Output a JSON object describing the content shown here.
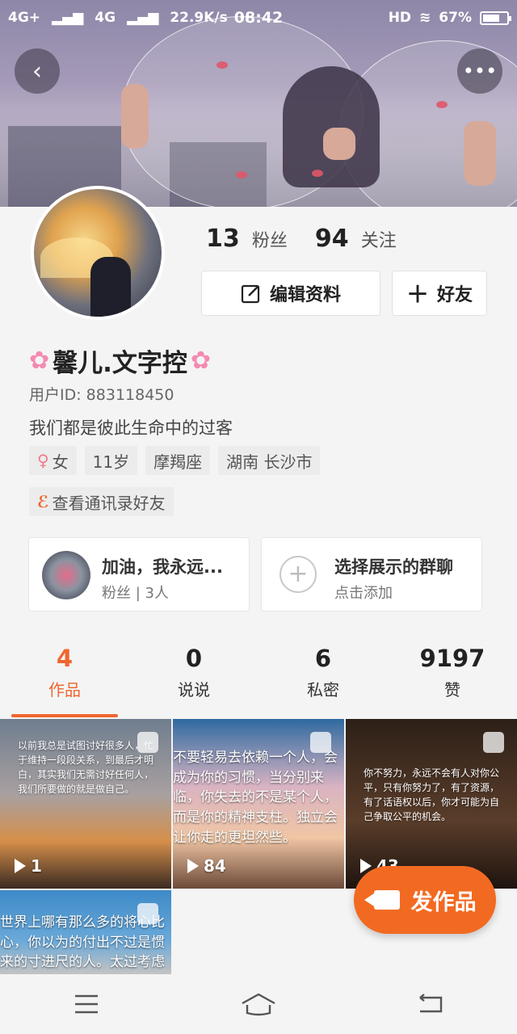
{
  "status_bar": {
    "network_1": "4G+",
    "network_2": "4G",
    "speed": "22.9K/s",
    "dots": "···",
    "time": "08:42",
    "hd": "HD",
    "battery": "67%"
  },
  "header": {
    "back_icon": "chevron-left",
    "more_icon": "ellipsis"
  },
  "profile": {
    "fans_count": "13",
    "fans_label": "粉丝",
    "following_count": "94",
    "following_label": "关注",
    "edit_button": "编辑资料",
    "add_friend_button": "好友",
    "name": "馨儿.文字控",
    "user_id": "用户ID: 883118450",
    "bio": "我们都是彼此生命中的过客",
    "tags": {
      "gender": "女",
      "age": "11岁",
      "zodiac": "摩羯座",
      "location": "湖南 长沙市"
    },
    "contacts_link": "查看通讯录好友"
  },
  "group_cards": {
    "group1": {
      "title": "加油，我永远...",
      "subtitle": "粉丝 | 3人"
    },
    "group2": {
      "title": "选择展示的群聊",
      "subtitle": "点击添加"
    }
  },
  "tabs": [
    {
      "count": "4",
      "label": "作品"
    },
    {
      "count": "0",
      "label": "说说"
    },
    {
      "count": "6",
      "label": "私密"
    },
    {
      "count": "9197",
      "label": "赞"
    }
  ],
  "works": [
    {
      "text": "以前我总是试图讨好很多人，忙于维持一段段关系，到最后才明白，其实我们无需讨好任何人，我们所要做的就是做自己。",
      "plays": "1"
    },
    {
      "text": "不要轻易去依赖一个人，会成为你的习惯，当分别来临，你失去的不是某个人，而是你的精神支柱。独立会让你走的更坦然些。",
      "plays": "84"
    },
    {
      "text": "你不努力，永远不会有人对你公平，只有你努力了，有了资源，有了话语权以后，你才可能为自己争取公平的机会。",
      "plays": "43"
    },
    {
      "text": "世界上哪有那么多的将心比心，你以为的付出不过是惯来的寸进尺的人。太过考虑别人的感受，就注定自己不"
    }
  ],
  "fab": {
    "label": "发作品"
  },
  "accent_color": "#f0662f"
}
